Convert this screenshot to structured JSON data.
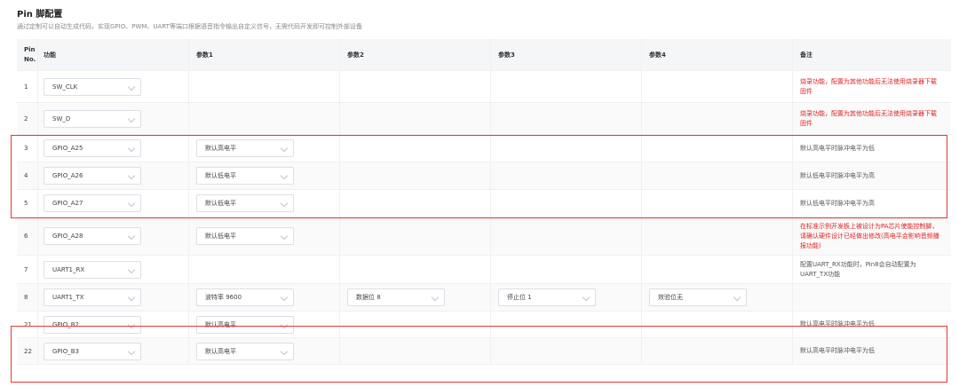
{
  "page": {
    "title": "Pin 脚配置",
    "subtitle": "通过定制可以自动生成代码，实现GPIO、PWM、UART等端口根据语音指令输出自定义信号，无需代码开发即可控制外部设备"
  },
  "table": {
    "headers": [
      "Pin No.",
      "功能",
      "参数1",
      "参数2",
      "参数3",
      "参数4",
      "备注"
    ],
    "rows": [
      {
        "pin": "1",
        "func": "SW_CLK",
        "p1": "",
        "p2": "",
        "p3": "",
        "p4": "",
        "note": "烧录功能，配置为其他功能后无法使用烧录器下载固件",
        "note_red": true
      },
      {
        "pin": "2",
        "func": "SW_D",
        "p1": "",
        "p2": "",
        "p3": "",
        "p4": "",
        "note": "烧录功能，配置为其他功能后无法使用烧录器下载固件",
        "note_red": true
      },
      {
        "pin": "3",
        "func": "GPIO_A25",
        "p1": "默认高电平",
        "p2": "",
        "p3": "",
        "p4": "",
        "note": "默认高电平时脉冲电平为低",
        "note_red": false
      },
      {
        "pin": "4",
        "func": "GPIO_A26",
        "p1": "默认低电平",
        "p2": "",
        "p3": "",
        "p4": "",
        "note": "默认低电平时脉冲电平为高",
        "note_red": false
      },
      {
        "pin": "5",
        "func": "GPIO_A27",
        "p1": "默认低电平",
        "p2": "",
        "p3": "",
        "p4": "",
        "note": "默认低电平时脉冲电平为高",
        "note_red": false
      },
      {
        "pin": "6",
        "func": "GPIO_A28",
        "p1": "默认低电平",
        "p2": "",
        "p3": "",
        "p4": "",
        "note": "在标准示例开发板上被设计为PA芯片使能控制脚，请确认硬件设计已经做出修改(高电平会影响音频播报功能)",
        "note_red": true
      },
      {
        "pin": "7",
        "func": "UART1_RX",
        "p1": "",
        "p2": "",
        "p3": "",
        "p4": "",
        "note": "配置UART_RX功能时，Pin8会自动配置为UART_TX功能",
        "note_red": false
      },
      {
        "pin": "8",
        "func": "UART1_TX",
        "p1": "波特率 9600",
        "p2": "数据位 8",
        "p3": "停止位 1",
        "p4": "效验位无",
        "note": "",
        "note_red": false
      },
      {
        "pin": "21",
        "func": "GPIO_B2",
        "p1": "默认高电平",
        "p2": "",
        "p3": "",
        "p4": "",
        "note": "默认高电平时脉冲电平为低",
        "note_red": false
      },
      {
        "pin": "22",
        "func": "GPIO_B3",
        "p1": "默认高电平",
        "p2": "",
        "p3": "",
        "p4": "",
        "note": "默认高电平时脉冲电平为低",
        "note_red": false
      }
    ]
  },
  "colors": {
    "warning_text": "#e02020",
    "highlight_border": "#e53935"
  }
}
